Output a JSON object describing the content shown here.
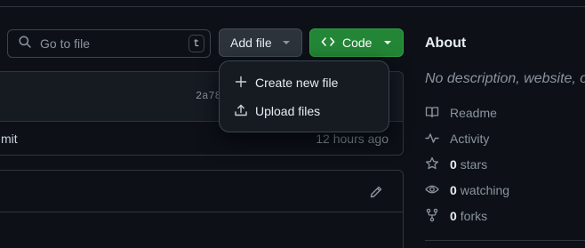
{
  "search": {
    "placeholder": "Go to file",
    "shortcut": "t"
  },
  "toolbar": {
    "add_file_label": "Add file",
    "code_label": "Code"
  },
  "add_file_menu": {
    "items": [
      {
        "label": "Create new file",
        "icon": "plus-icon"
      },
      {
        "label": "Upload files",
        "icon": "upload-icon"
      }
    ]
  },
  "latest_commit": {
    "hash_partial": "2a78",
    "message_partial": "mit",
    "time": "12 hours ago"
  },
  "about": {
    "title": "About",
    "description": "No description, website, or",
    "readme": "Readme",
    "activity": "Activity",
    "stars_count": "0",
    "stars_label": "stars",
    "watching_count": "0",
    "watching_label": "watching",
    "forks_count": "0",
    "forks_label": "forks"
  },
  "colors": {
    "code_button": "#238636",
    "background": "#0d1117",
    "menu_bg": "#161b22"
  }
}
